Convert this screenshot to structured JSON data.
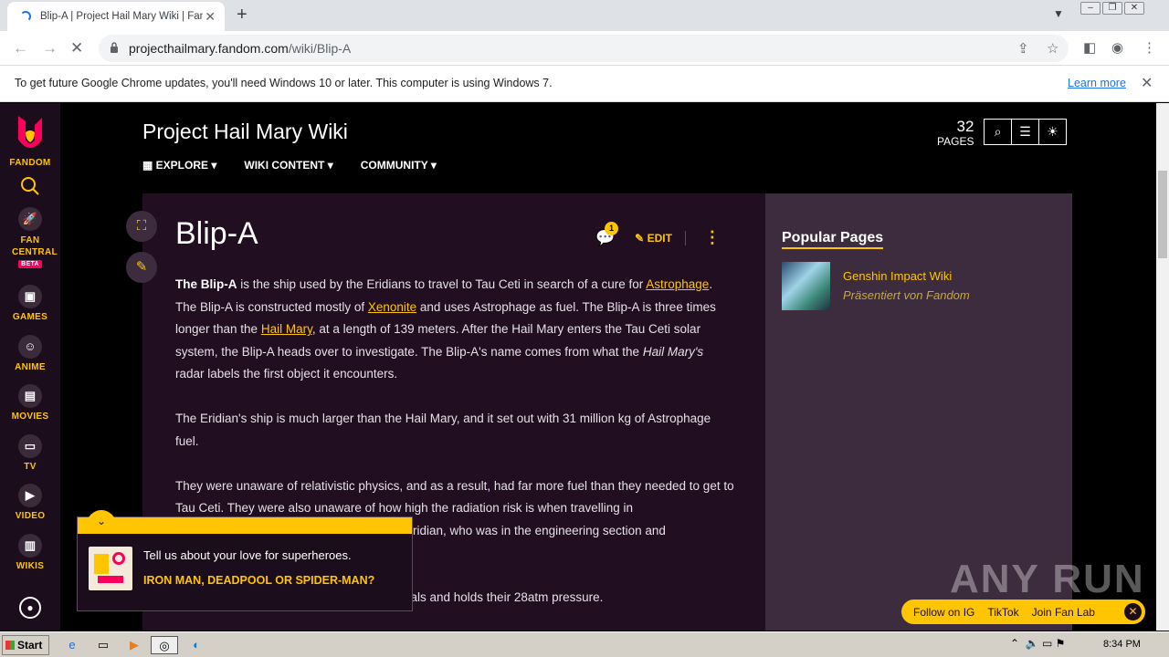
{
  "browser": {
    "tab_title": "Blip-A | Project Hail Mary Wiki | Fandom",
    "tab_close": "✕",
    "new_tab": "+",
    "url_host": "projecthailmary.fandom.com",
    "url_path": "/wiki/Blip-A"
  },
  "infobar": {
    "message": "To get future Google Chrome updates, you'll need Windows 10 or later. This computer is using Windows 7.",
    "learn_more": "Learn more"
  },
  "rail": {
    "brand": "FANDOM",
    "items": [
      {
        "label": "FAN CENTRAL",
        "badge": "BETA"
      },
      {
        "label": "GAMES"
      },
      {
        "label": "ANIME"
      },
      {
        "label": "MOVIES"
      },
      {
        "label": "TV"
      },
      {
        "label": "VIDEO"
      },
      {
        "label": "WIKIS"
      }
    ]
  },
  "wiki": {
    "name": "Project Hail Mary Wiki",
    "nav": [
      "EXPLORE",
      "WIKI CONTENT",
      "COMMUNITY"
    ],
    "pages_count": "32",
    "pages_label": "PAGES"
  },
  "article": {
    "title": "Blip-A",
    "comment_count": "1",
    "edit_label": "EDIT",
    "p1": {
      "bold": "The Blip-A",
      "t1": " is the ship used by the Eridians to travel to Tau Ceti in search of a cure for ",
      "link1": "Astrophage",
      "t2": ". The Blip-A is constructed mostly of ",
      "link2": "Xenonite",
      "t3": " and uses Astrophage as fuel. The Blip-A is three times longer than the ",
      "link3": "Hail Mary",
      "t4": ", at a length of 139 meters. After the Hail Mary enters the Tau Ceti solar system, the Blip-A heads over to investigate. The Blip-A's name comes from what the ",
      "italic": "Hail Mary's",
      "t5": " radar labels the first object it encounters."
    },
    "p2": "The Eridian's ship is much larger than the Hail Mary, and it set out with 31 million kg of Astrophage fuel.",
    "p3": "They were unaware of relativistic physics, and as a result, had far more fuel than they needed to get to Tau Ceti. They were also unaware of how high the radiation risk is when travelling in",
    "p3_line3_visible": "ridian, who was in the engineering section and",
    "p4_visible": "rials and holds their 28atm pressure."
  },
  "sidebar": {
    "title": "Popular Pages",
    "item_name": "Genshin Impact Wiki",
    "item_sub": "Präsentiert von Fandom"
  },
  "promo": {
    "question": "Tell us about your love for superheroes.",
    "cta": "IRON MAN, DEADPOOL OR SPIDER-MAN?"
  },
  "follow": {
    "items": [
      "Follow on IG",
      "TikTok",
      "Join Fan Lab"
    ]
  },
  "watermark": "ANY RUN",
  "taskbar": {
    "start": "Start",
    "time": "8:34 PM"
  }
}
